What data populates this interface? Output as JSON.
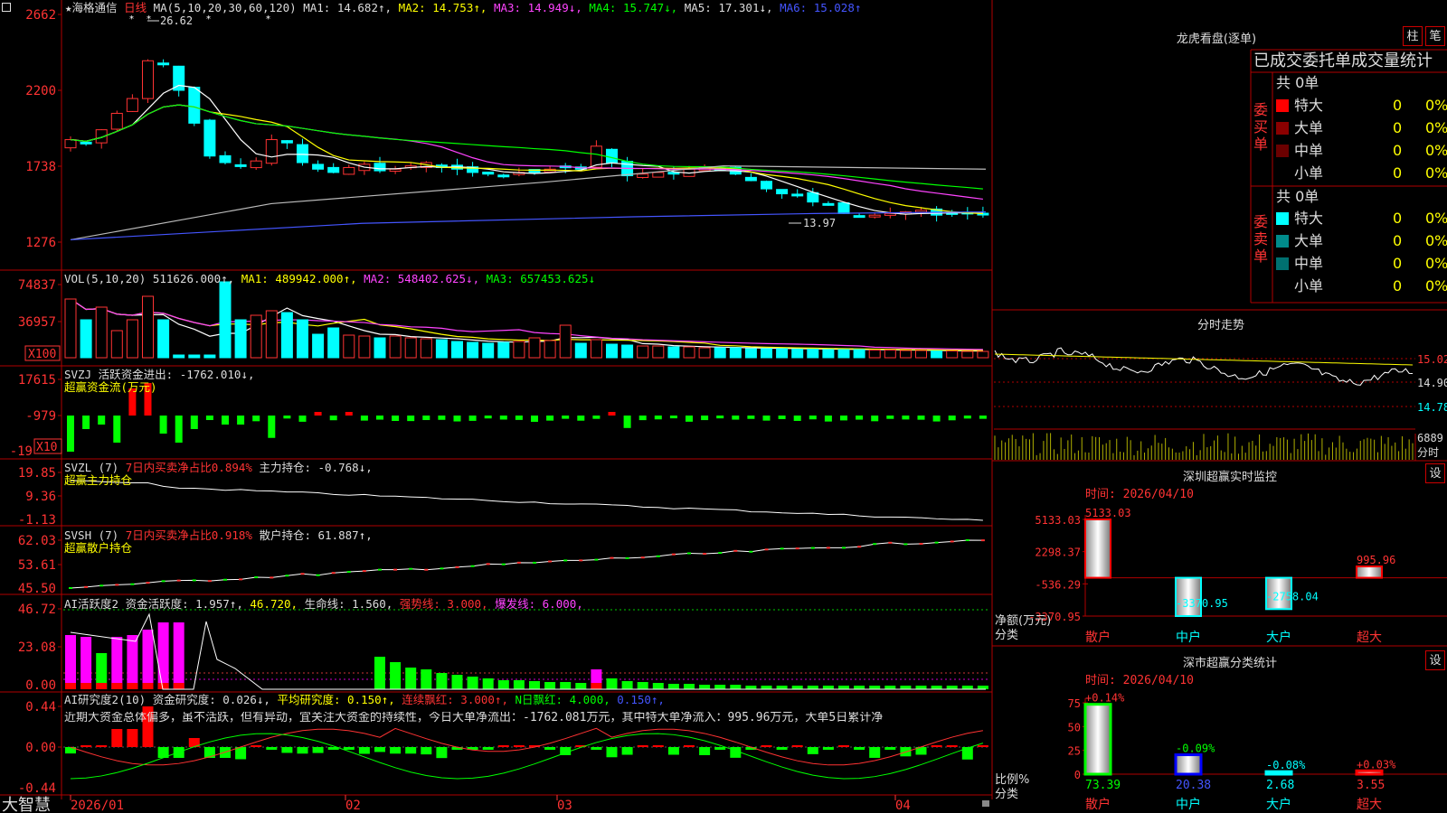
{
  "brand": "大智慧",
  "stock": {
    "star": "★",
    "name": "海格通信",
    "period": "日线"
  },
  "main_hdr": {
    "ma_def": "MA(5,10,20,30,60,120)",
    "ma1": "MA1: 14.682↑,",
    "ma2": "MA2: 14.753↑,",
    "ma3": "MA3: 14.949↓,",
    "ma4": "MA4: 15.747↓,",
    "ma5": "MA5: 17.301↓,",
    "ma6": "MA6: 15.028↑"
  },
  "price_axis": [
    "2662",
    "2200",
    "1738",
    "1276"
  ],
  "price_marks": {
    "high": "26.62",
    "low": "13.97"
  },
  "vol_hdr": {
    "def": "VOL(5,10,20)",
    "v": "511626.000↑,",
    "ma1": "MA1: 489942.000↑,",
    "ma2": "MA2: 548402.625↓,",
    "ma3": "MA3: 657453.625↓"
  },
  "vol_axis": [
    "74837",
    "36957"
  ],
  "vol_unit": "X100",
  "svzj_hdr": {
    "def": "SVZJ",
    "text": "活跃资金进出: -1762.010↓,",
    "sub": "超赢资金流(万元)"
  },
  "svzj_axis": [
    "17615",
    "-979",
    "-19"
  ],
  "svzj_unit": "X10",
  "svzl_hdr": {
    "def": "SVZL (7)",
    "t1": "7日内买卖净占比0.894%",
    "t2": "主力持仓: -0.768↓,",
    "sub": "超赢主力持仓"
  },
  "svzl_axis": [
    "19.85",
    "9.36",
    "-1.13"
  ],
  "svsh_hdr": {
    "def": "SVSH (7)",
    "t1": "7日内买卖净占比0.918%",
    "t2": "散户持仓: 61.887↑,",
    "sub": "超赢散户持仓"
  },
  "svsh_axis": [
    "62.03",
    "53.61",
    "45.50"
  ],
  "ai_hdr": {
    "def": "AI活跃度2",
    "t1": "资金活跃度: 1.957↑,",
    "t2": "46.720,",
    "t3": "生命线: 1.560,",
    "t4": "强势线: 3.000,",
    "t5": "爆发线: 6.000,"
  },
  "ai_axis": [
    "46.72",
    "23.08",
    "0.00"
  ],
  "air_hdr": {
    "def": "AI研究度2(10)",
    "t1": "资金研究度: 0.026↓,",
    "t2": "平均研究度: 0.150↑,",
    "t3": "连续飘红: 3.000↑,",
    "t4": "N日飘红: 4.000,",
    "t5": "0.150↑,"
  },
  "air_text": "近期大资金总体偏多，虽不活跃，但有异动，宜关注大资金的持续性，今日大单净流出：-1762.081万元，其中特大单净流入：995.96万元，大单5日累计净",
  "air_axis": [
    "0.44",
    "0.00",
    "-0.44"
  ],
  "x_axis": [
    "2026/01",
    "02",
    "03",
    "04"
  ],
  "right": {
    "longhu_title": "龙虎看盘(逐单)",
    "btn_zhu": "柱",
    "btn_bi": "笔",
    "tbl_title": "已成交委托单成交量统计",
    "buy_label": "委买单",
    "sell_label": "委卖单",
    "buy_total": "共 0单",
    "sell_total": "共 0单",
    "rows": [
      {
        "name": "特大",
        "v": "0",
        "p": "0%"
      },
      {
        "name": "大单",
        "v": "0",
        "p": "0%"
      },
      {
        "name": "中单",
        "v": "0",
        "p": "0%"
      },
      {
        "name": "小单",
        "v": "0",
        "p": "0%"
      }
    ],
    "buy_colors": [
      "#ff0000",
      "#8b0000",
      "#6b0000",
      "#000000"
    ],
    "sell_colors": [
      "#00ffff",
      "#008b8b",
      "#007070",
      "#000000"
    ],
    "fenshi_title": "分时走势",
    "fenshi_axis": [
      "15.02",
      "14.90",
      "14.78"
    ],
    "fenshi_vol": "6889",
    "fenshi_unit": "分时",
    "sz_title": "深圳超赢实时监控",
    "sz_btn": "设",
    "sz_time": "时间: 2026/04/10",
    "sz_axis": [
      "5133.03",
      "2298.37",
      "-536.29",
      "-3370.95"
    ],
    "sz_ylabel": "净额(万元)",
    "sz_xlabel": "分类",
    "sc_title": "深市超赢分类统计",
    "sc_btn": "设",
    "sc_time": "时间: 2026/04/10",
    "sc_axis": [
      "75",
      "50",
      "25",
      "0"
    ],
    "sc_ylabel": "比例%",
    "sc_xlabel": "分类"
  },
  "chart_data": [
    {
      "type": "bar",
      "title": "深圳超赢实时监控",
      "categories": [
        "散户",
        "中户",
        "大户",
        "超大"
      ],
      "values": [
        5133.03,
        -3370.95,
        -2758.04,
        995.96
      ],
      "value_labels": [
        "5133.03",
        "-3370.95",
        "-2758.04",
        "995.96"
      ],
      "ylim": [
        -3370.95,
        5133.03
      ],
      "ylabel": "净额(万元)",
      "xlabel": "分类"
    },
    {
      "type": "bar",
      "title": "深市超赢分类统计",
      "categories": [
        "散户",
        "中户",
        "大户",
        "超大"
      ],
      "values": [
        73.39,
        20.38,
        2.68,
        3.55
      ],
      "value_labels": [
        "73.39",
        "20.38",
        "2.68",
        "3.55"
      ],
      "change_labels": [
        "+0.14%",
        "-0.09%",
        "-0.08%",
        "+0.03%"
      ],
      "ylim": [
        0,
        75
      ],
      "ylabel": "比例%",
      "xlabel": "分类"
    }
  ]
}
